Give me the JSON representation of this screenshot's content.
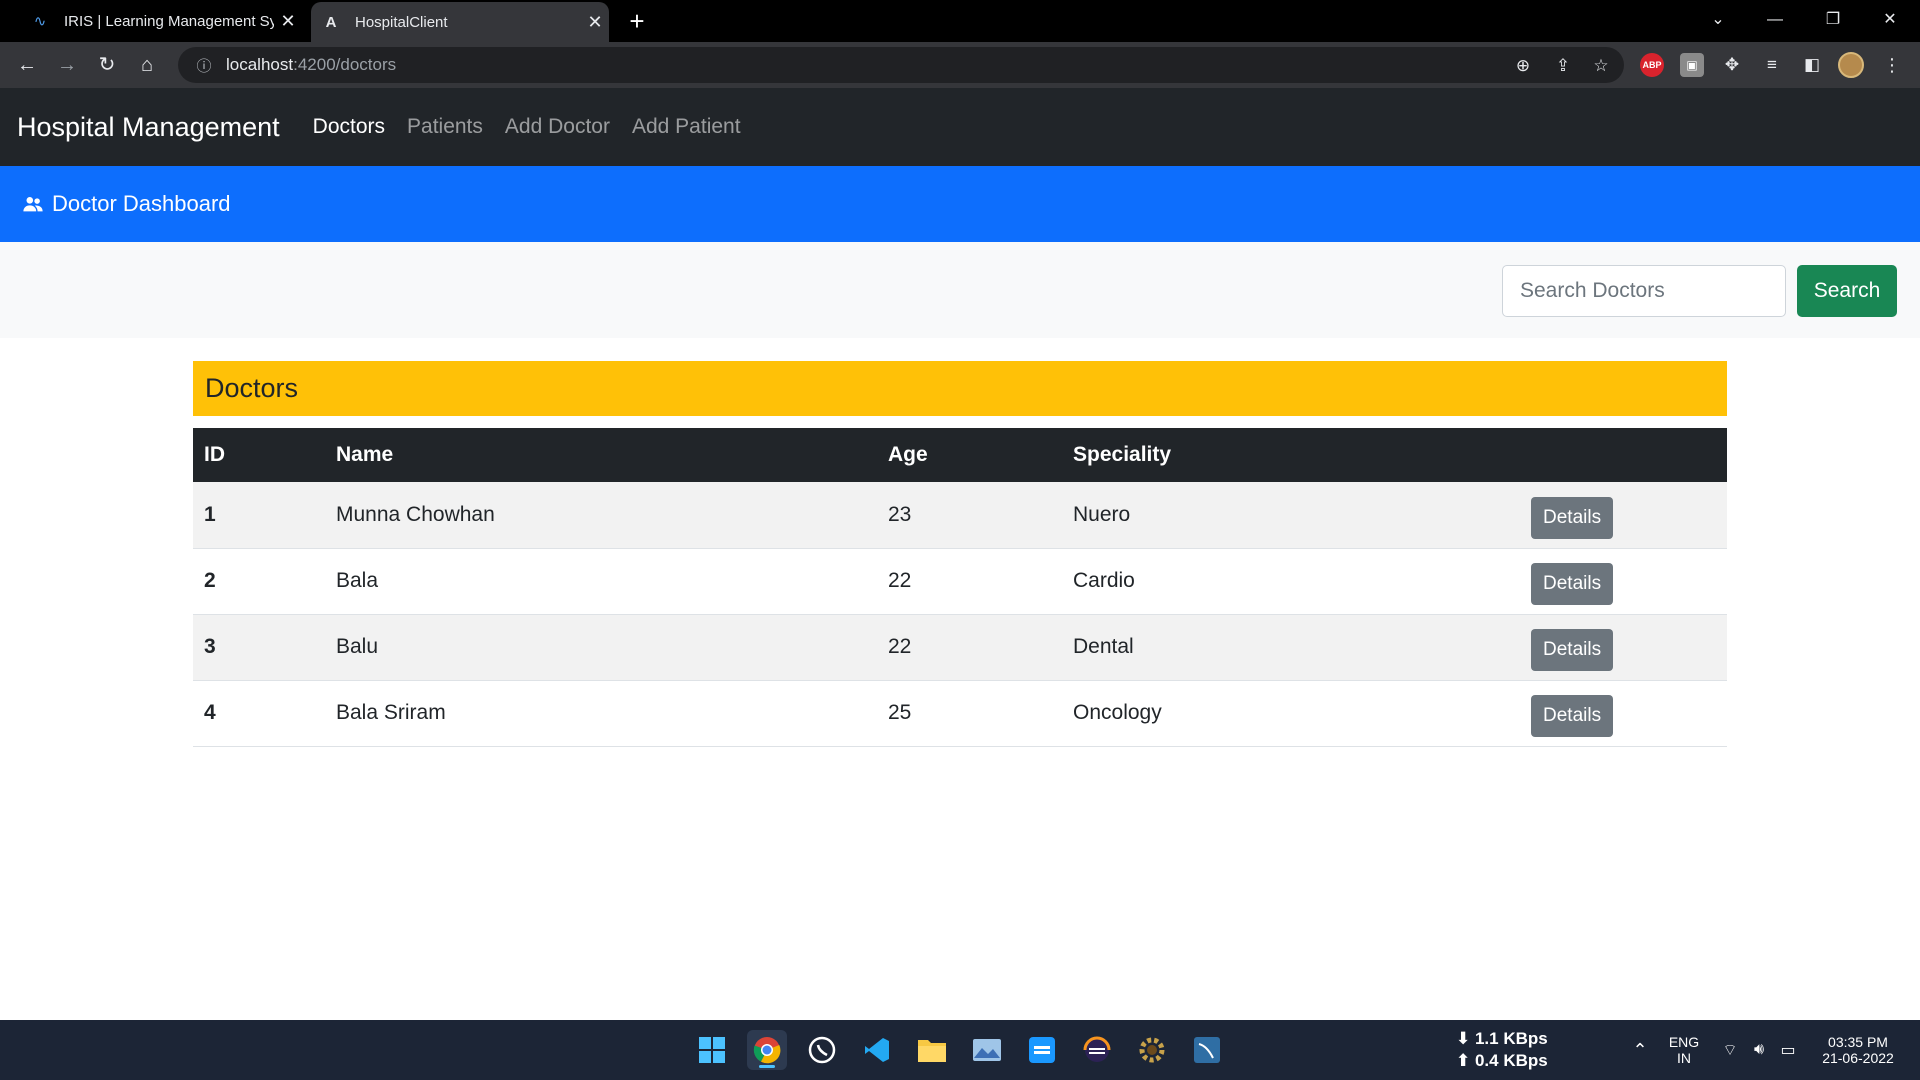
{
  "browser": {
    "tabs": [
      {
        "title": "IRIS | Learning Management Syst",
        "icon": "iris-favicon-icon"
      },
      {
        "title": "HospitalClient",
        "icon": "angular-favicon-icon"
      }
    ],
    "url_host": "localhost",
    "url_path": ":4200/doctors",
    "extensions": {
      "abp_label": "ABP"
    }
  },
  "app": {
    "brand": "Hospital Management",
    "nav": [
      {
        "label": "Doctors",
        "active": true
      },
      {
        "label": "Patients",
        "active": false
      },
      {
        "label": "Add Doctor",
        "active": false
      },
      {
        "label": "Add Patient",
        "active": false
      }
    ],
    "banner_title": "Doctor Dashboard",
    "search": {
      "placeholder": "Search Doctors",
      "value": "",
      "button_label": "Search"
    },
    "section_title": "Doctors",
    "table": {
      "columns": [
        "ID",
        "Name",
        "Age",
        "Speciality",
        ""
      ],
      "rows": [
        {
          "id": "1",
          "name": "Munna Chowhan",
          "age": "23",
          "speciality": "Nuero",
          "action": "Details"
        },
        {
          "id": "2",
          "name": "Bala",
          "age": "22",
          "speciality": "Cardio",
          "action": "Details"
        },
        {
          "id": "3",
          "name": "Balu",
          "age": "22",
          "speciality": "Dental",
          "action": "Details"
        },
        {
          "id": "4",
          "name": "Bala Sriram",
          "age": "25",
          "speciality": "Oncology",
          "action": "Details"
        }
      ]
    }
  },
  "taskbar": {
    "net_down": "1.1 KBps",
    "net_up": "0.4 KBps",
    "lang": "ENG",
    "region": "IN",
    "time": "03:35 PM",
    "date": "21-06-2022"
  },
  "colors": {
    "navbar": "#212529",
    "banner": "#0d6efd",
    "heading": "#ffc107",
    "search_button": "#198754",
    "details_button": "#6c757d"
  }
}
